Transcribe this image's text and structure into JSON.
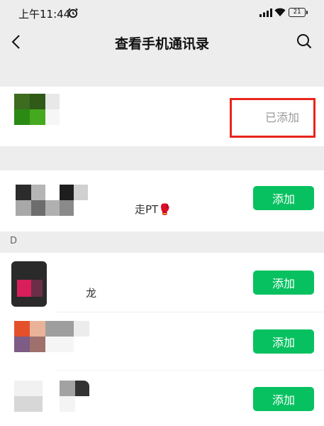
{
  "status_bar": {
    "time": "上午11:44",
    "battery": "21"
  },
  "nav": {
    "title": "查看手机通讯录"
  },
  "sections": [
    {
      "letter": "D"
    }
  ],
  "contacts": [
    {
      "name": "",
      "action": "已添加",
      "added": true
    },
    {
      "name": "走PT",
      "emoji": "🥊",
      "action": "添加",
      "added": false
    },
    {
      "name": "龙",
      "action": "添加",
      "added": false
    },
    {
      "name": "",
      "action": "添加",
      "added": false
    },
    {
      "name": "",
      "action": "添加",
      "added": false
    }
  ],
  "colors": {
    "accent": "#07c160",
    "highlight": "#e8251c"
  }
}
